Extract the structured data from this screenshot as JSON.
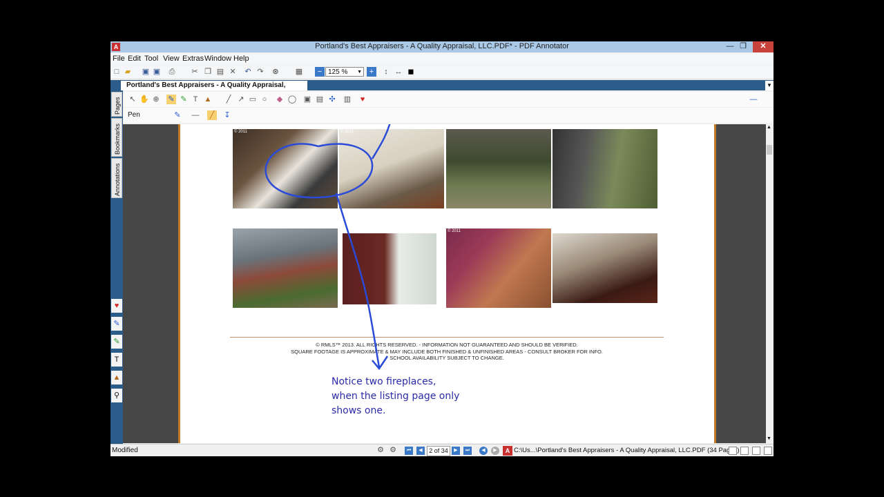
{
  "window": {
    "title": "Portland's Best Appraisers - A Quality Appraisal, LLC.PDF* - PDF Annotator",
    "app_icon": "A",
    "controls": [
      "—",
      "❐",
      "✕"
    ]
  },
  "menu": [
    "File",
    "Edit",
    "Tool",
    "View",
    "Extras",
    "Window",
    "Help"
  ],
  "toolbar": {
    "zoom_value": "125 %"
  },
  "doc_tab": {
    "label": "Portland's Best Appraisers - A Quality Appraisal, LLC.PDF*"
  },
  "side_tabs": [
    "Pages",
    "Bookmarks",
    "Annotations"
  ],
  "pen_toolbar": {
    "label": "Pen"
  },
  "photos": [
    {
      "name": "living-room-fireplace-photo",
      "tag": "© 2011"
    },
    {
      "name": "family-room-photo",
      "tag": "© 2011"
    },
    {
      "name": "forest-hillside-photo",
      "tag": ""
    },
    {
      "name": "deck-bamboo-photo",
      "tag": ""
    },
    {
      "name": "front-garden-photo",
      "tag": ""
    },
    {
      "name": "bedroom-doors-photo",
      "tag": ""
    },
    {
      "name": "wine-cellar-photo",
      "tag": "© 2011"
    },
    {
      "name": "kitchen-photo",
      "tag": ""
    }
  ],
  "disclaimer": {
    "line1": "© RMLS™ 2013. ALL RIGHTS RESERVED. - INFORMATION NOT GUARANTEED AND SHOULD BE VERIFIED.",
    "line2": "SQUARE FOOTAGE IS APPROXIMATE & MAY INCLUDE BOTH FINISHED & UNFINISHED AREAS - CONSULT BROKER FOR INFO.",
    "line3": "SCHOOL AVAILABILITY SUBJECT TO CHANGE."
  },
  "annotation_note": {
    "line1": "Notice two fireplaces,",
    "line2": "when the listing page only",
    "line3": "shows one."
  },
  "status": {
    "state": "Modified",
    "page_indicator": "2 of 34",
    "file_path": "C:\\Us...\\Portland's Best Appraisers - A Quality Appraisal, LLC.PDF (34 Pages)"
  },
  "colors": {
    "accent": "#2b5c8a",
    "annotation_ink": "#2a2aa8",
    "page_border": "#c07a2a",
    "title_bar": "#a9c9e6"
  }
}
